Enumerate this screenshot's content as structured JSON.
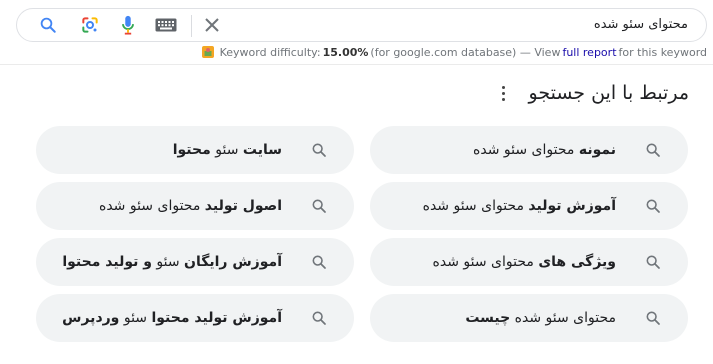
{
  "search": {
    "query": "محتوای سئو شده"
  },
  "keyword_bar": {
    "label": "Keyword difficulty:",
    "value": "15.00%",
    "db_note": "(for google.com database) — View",
    "report_link": "full report",
    "suffix": "for this keyword"
  },
  "related": {
    "title": "مرتبط با این جستجو",
    "chips": [
      {
        "bold_first": true,
        "bold": "نمونه",
        "normal": "محتوای سئو شده",
        "bold_end": ""
      },
      {
        "bold_first": true,
        "bold": "سایت",
        "normal": "سئو",
        "bold_end": "محتوا"
      },
      {
        "bold_first": true,
        "bold": "آموزش تولید",
        "normal": "محتوای سئو شده",
        "bold_end": ""
      },
      {
        "bold_first": true,
        "bold": "اصول تولید",
        "normal": "محتوای سئو شده",
        "bold_end": ""
      },
      {
        "bold_first": true,
        "bold": "ویژگی های",
        "normal": "محتوای سئو شده",
        "bold_end": ""
      },
      {
        "bold_first": true,
        "bold": "آموزش رایگان",
        "normal": "سئو",
        "bold_end": "و تولید محتوا"
      },
      {
        "bold_first": false,
        "bold": "",
        "normal": "محتوای سئو شده",
        "bold_end": "چیست"
      },
      {
        "bold_first": true,
        "bold": "آموزش تولید محتوا",
        "normal": "سئو",
        "bold_end": "وردپرس"
      }
    ]
  },
  "colors": {
    "google_blue": "#4285f4",
    "google_red": "#ea4335",
    "google_yellow": "#fbbc04",
    "google_green": "#34a853",
    "chip_bg": "#f1f3f4",
    "link": "#1a0dab"
  }
}
